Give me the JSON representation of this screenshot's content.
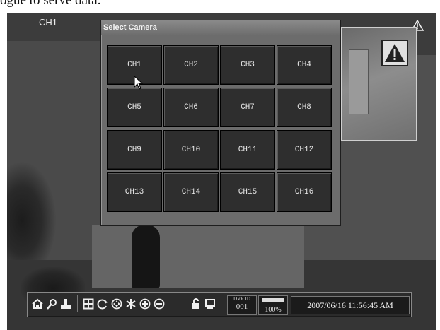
{
  "page": {
    "caption": "ogue to serve data."
  },
  "display": {
    "channel": "CH1",
    "alarm_icon": "warning-triangle-icon"
  },
  "dialog": {
    "title": "Select Camera",
    "cameras": [
      "CH1",
      "CH2",
      "CH3",
      "CH4",
      "CH5",
      "CH6",
      "CH7",
      "CH8",
      "CH9",
      "CH10",
      "CH11",
      "CH12",
      "CH13",
      "CH14",
      "CH15",
      "CH16"
    ]
  },
  "toolbar": {
    "icons": [
      "home-icon",
      "search-icon",
      "person-icon",
      "split-screen-icon",
      "refresh-icon",
      "ptz-icon",
      "freeze-icon",
      "zoom-in-icon",
      "zoom-out-icon",
      "lock-icon",
      "monitor-icon"
    ],
    "dvr_id_label": "DVR ID",
    "dvr_id_value": "001",
    "hdd_usage": "100%",
    "datetime": "2007/06/16 11:56:45 AM"
  }
}
